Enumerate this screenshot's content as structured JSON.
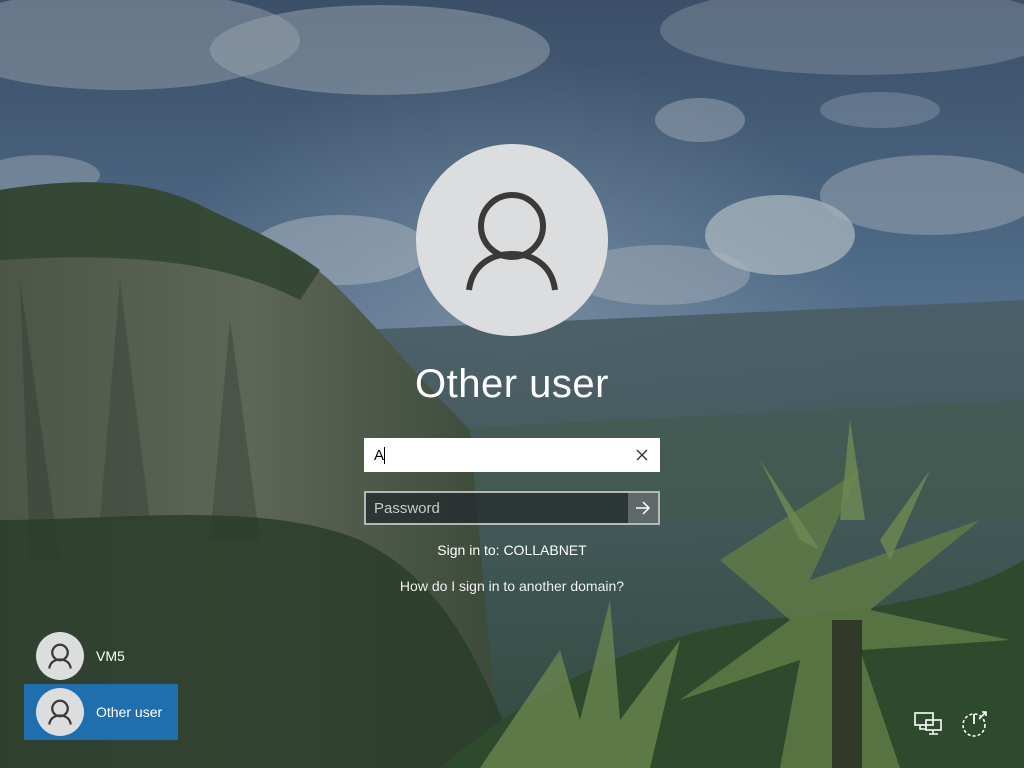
{
  "login": {
    "username": "Other user",
    "username_value": "A",
    "password_placeholder": "Password",
    "sign_in_to": "Sign in to: COLLABNET",
    "other_domain_link": "How do I sign in to another domain?"
  },
  "users": [
    {
      "name": "VM5",
      "selected": false
    },
    {
      "name": "Other user",
      "selected": true
    }
  ],
  "icons": {
    "avatar": "person-silhouette-icon",
    "clear": "close-icon",
    "submit": "arrow-right-icon",
    "network": "network-icon",
    "power": "power-icon"
  },
  "colors": {
    "selected_tile": "#1f6fae",
    "avatar_bg": "#dcdddf"
  }
}
